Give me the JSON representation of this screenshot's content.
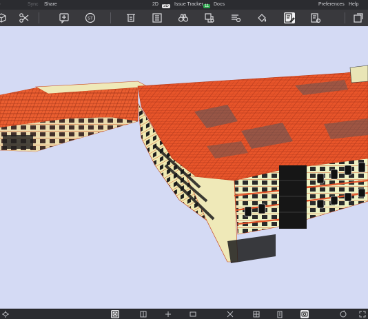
{
  "menubar": {
    "sync": "Sync",
    "share": "Share",
    "view_2d": "2D",
    "view_3d": "3D",
    "issue_tracker": "Issue Tracker",
    "issue_count": "11",
    "docs": "Docs",
    "preferences": "Preferences",
    "help": "Help"
  },
  "toolbar": {
    "st_label": "ST"
  }
}
